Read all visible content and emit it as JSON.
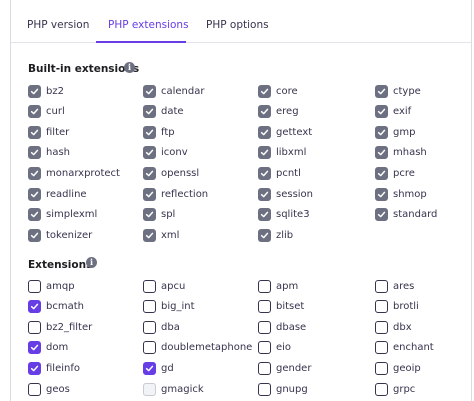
{
  "tabs": [
    {
      "label": "PHP version",
      "active": false
    },
    {
      "label": "PHP extensions",
      "active": true
    },
    {
      "label": "PHP options",
      "active": false
    }
  ],
  "builtin": {
    "title": "Built-in extensions",
    "items": [
      "bz2",
      "calendar",
      "core",
      "ctype",
      "curl",
      "date",
      "ereg",
      "exif",
      "filter",
      "ftp",
      "gettext",
      "gmp",
      "hash",
      "iconv",
      "libxml",
      "mhash",
      "monarxprotect",
      "openssl",
      "pcntl",
      "pcre",
      "readline",
      "reflection",
      "session",
      "shmop",
      "simplexml",
      "spl",
      "sqlite3",
      "standard",
      "tokenizer",
      "xml",
      "zlib"
    ]
  },
  "extensions": {
    "title": "Extensions",
    "items": [
      {
        "label": "amqp",
        "state": "unchecked"
      },
      {
        "label": "apcu",
        "state": "unchecked"
      },
      {
        "label": "apm",
        "state": "unchecked"
      },
      {
        "label": "ares",
        "state": "unchecked"
      },
      {
        "label": "bcmath",
        "state": "checked"
      },
      {
        "label": "big_int",
        "state": "unchecked"
      },
      {
        "label": "bitset",
        "state": "unchecked"
      },
      {
        "label": "brotli",
        "state": "unchecked"
      },
      {
        "label": "bz2_filter",
        "state": "unchecked"
      },
      {
        "label": "dba",
        "state": "unchecked"
      },
      {
        "label": "dbase",
        "state": "unchecked"
      },
      {
        "label": "dbx",
        "state": "unchecked"
      },
      {
        "label": "dom",
        "state": "checked"
      },
      {
        "label": "doublemetaphone",
        "state": "unchecked"
      },
      {
        "label": "eio",
        "state": "unchecked"
      },
      {
        "label": "enchant",
        "state": "unchecked"
      },
      {
        "label": "fileinfo",
        "state": "checked"
      },
      {
        "label": "gd",
        "state": "checked"
      },
      {
        "label": "gender",
        "state": "unchecked"
      },
      {
        "label": "geoip",
        "state": "unchecked"
      },
      {
        "label": "geos",
        "state": "unchecked"
      },
      {
        "label": "gmagick",
        "state": "disabled"
      },
      {
        "label": "gnupg",
        "state": "unchecked"
      },
      {
        "label": "grpc",
        "state": "unchecked"
      }
    ]
  },
  "colors": {
    "accent": "#673de6",
    "builtin_checkbox": "#6d7081",
    "text": "#36344d"
  }
}
